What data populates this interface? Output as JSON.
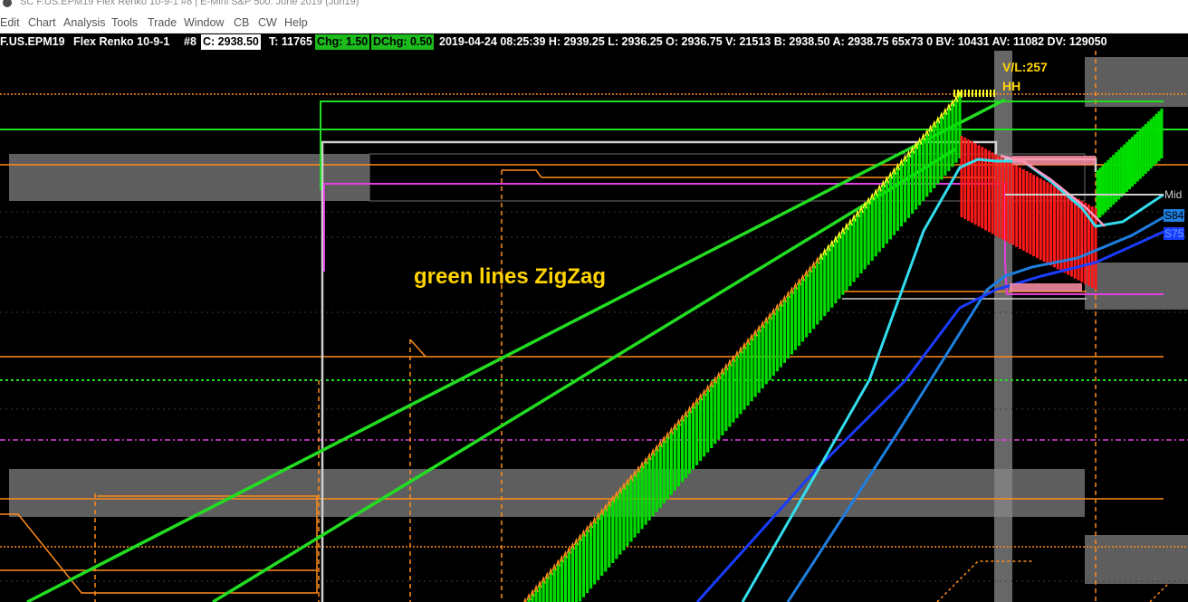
{
  "window": {
    "title": "SC F.US.EPM19  Flex Renko 10-9-1  #8 | E-Mini S&P 500: June 2019 (Jun19)"
  },
  "menu": {
    "items": [
      "Edit",
      "Chart",
      "Analysis",
      "Tools",
      "Trade",
      "Window",
      "CB",
      "CW",
      "Help"
    ]
  },
  "info_bar": {
    "symbol": "F.US.EPM19",
    "bar_type": "Flex Renko 10-9-1",
    "chart_number": "#8",
    "close": "C: 2938.50",
    "trades": "T: 11765",
    "change": "Chg: 1.50",
    "daily_change": "DChg: 0.50",
    "stats": "2019-04-24 08:25:39 H: 2939.25 L: 2936.25 O: 2936.75 V: 21513 B: 2938.50 A: 2938.75 65x73 0 BV: 10431 AV: 11082 DV: 129050"
  },
  "chart": {
    "annotation_text": "green lines  ZigZag",
    "swing_labels": {
      "volume_label": "V/L:257",
      "high_label": "HH"
    },
    "right_tags": {
      "mid": "Mid",
      "s84": "S84",
      "s75": "S75"
    },
    "colors": {
      "background": "#000000",
      "up_bar": "#00e000",
      "down_bar": "#ff0000",
      "zigzag": "#22dd22",
      "orange_levels": "#ff8c1a",
      "zone_fill": "#6e6e6e",
      "magenta_line": "#e040e0",
      "annotation": "#ffd400",
      "moving_avg_1": "#33ddee",
      "moving_avg_2": "#1a3cff",
      "moving_avg_3": "#1e7fe0"
    }
  }
}
